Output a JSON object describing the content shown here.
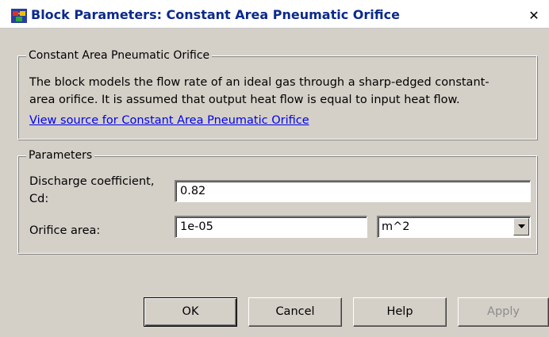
{
  "window": {
    "title": "Block Parameters: Constant Area Pneumatic Orifice",
    "close_glyph": "✕"
  },
  "description_group": {
    "legend": "Constant Area Pneumatic Orifice",
    "lines": [
      "The block models the flow rate of an ideal gas through a sharp-edged constant-",
      "area orifice. It is assumed that output heat flow is equal to input heat flow."
    ],
    "link": "View source for Constant Area Pneumatic Orifice"
  },
  "parameters_group": {
    "legend": "Parameters",
    "discharge_label_line1": "Discharge coefficient,",
    "discharge_label_line2": "Cd:",
    "discharge_value": "0.82",
    "area_label": "Orifice area:",
    "area_value": "1e-05",
    "area_unit": "m^2"
  },
  "buttons": {
    "ok": "OK",
    "cancel": "Cancel",
    "help": "Help",
    "apply": "Apply"
  },
  "colors": {
    "dialog_bg": "#d4d0c8",
    "title_text": "#0b2a8a",
    "link": "#0000ee",
    "disabled_text": "#8c8c8c"
  },
  "icons": {
    "app": "simulink-block-icon",
    "close": "close-icon",
    "dropdown": "chevron-down-icon"
  }
}
